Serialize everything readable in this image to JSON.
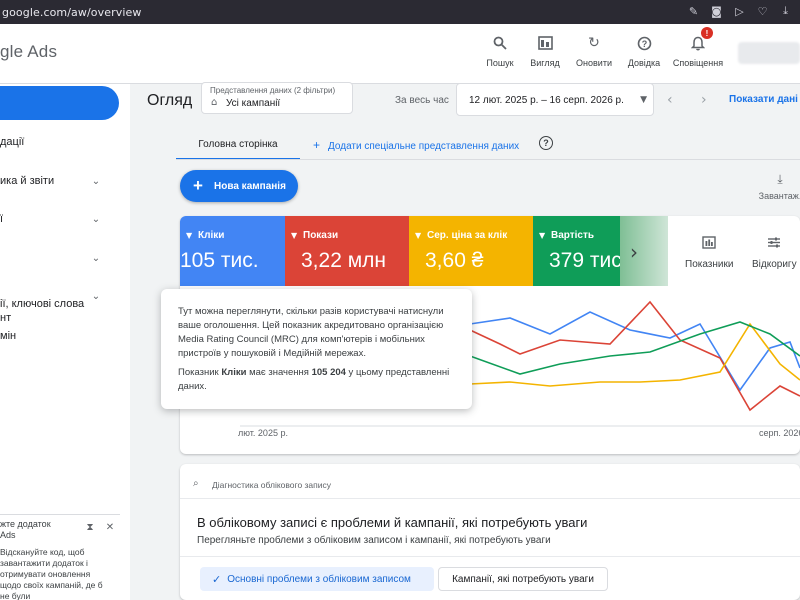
{
  "browser": {
    "url": "google.com/aw/overview",
    "icons": [
      "edit-icon",
      "camera-icon",
      "send-icon",
      "heart-icon",
      "download-icon"
    ]
  },
  "header": {
    "logo_text": "gle Ads",
    "tools": [
      {
        "icon": "search-icon",
        "label": "Пошук"
      },
      {
        "icon": "view-icon",
        "label": "Вигляд"
      },
      {
        "icon": "refresh-icon",
        "label": "Оновити"
      },
      {
        "icon": "help-icon",
        "label": "Довідка"
      },
      {
        "icon": "bell-icon",
        "label": "Сповіщення",
        "badge": "!"
      }
    ]
  },
  "sidebar": {
    "items": [
      {
        "label": "дації",
        "expandable": false
      },
      {
        "label": "ика й звіти",
        "expandable": true
      },
      {
        "label": "ї",
        "expandable": true
      },
      {
        "label": "",
        "expandable": true
      },
      {
        "label": "ії, ключові слова\nнт",
        "expandable": true
      },
      {
        "label": "мін",
        "expandable": false
      }
    ],
    "promo": {
      "title": "жте додаток\nAds",
      "body": "Відскануйте код, щоб\nзавантажити додаток і\nотримувати оновлення\nщодо своїх кампаній, де б\nне були"
    }
  },
  "main": {
    "title": "Огляд",
    "data_view": {
      "caption": "Представлення даних (2 фільтри)",
      "value": "Усі кампанії"
    },
    "period_label": "За весь час",
    "date_range": "12 лют. 2025 р. – 16 серп. 2026 р.",
    "show_last": "Показати дані з",
    "tabs": {
      "main": "Головна сторінка",
      "add": "Додати спеціальне представлення даних"
    },
    "new_campaign": "Нова кампанія",
    "download_label": "Завантаж."
  },
  "metrics": [
    {
      "name": "Кліки",
      "value": "105 тис.",
      "color": "#4285f4"
    },
    {
      "name": "Покази",
      "value": "3,22 млн",
      "color": "#db4437"
    },
    {
      "name": "Сер. ціна за клік",
      "value": "3,60 ₴",
      "color": "#f4b400"
    },
    {
      "name": "Вартість",
      "value": "379 тис. ₴",
      "color": "#0f9d58"
    }
  ],
  "metric_tools": [
    {
      "icon": "metrics-icon",
      "label": "Показники"
    },
    {
      "icon": "adjust-icon",
      "label": "Відкоригу"
    }
  ],
  "chart": {
    "axis_start": "лют. 2025 р.",
    "axis_end": "серп. 2026 р."
  },
  "tooltip": {
    "p1": "Тут можна переглянути, скільки разів користувачі натиснули ваше оголошення. Цей показник акредитовано організацією Media Rating Council (MRC) для комп'ютерів і мобільних пристроїв у пошуковій і Медійній мережах.",
    "p2_prefix": "Показник ",
    "p2_metric": "Кліки",
    "p2_mid": " має значення ",
    "p2_value": "105 204",
    "p2_suffix": " у цьому представленні даних."
  },
  "diagnostics": {
    "header": "Діагностика облікового запису",
    "title": "В обліковому записі є проблеми й кампанії, які потребують уваги",
    "subtitle": "Перегляньте проблеми з обліковим записом і кампанії, які потребують уваги",
    "chip_main": "Основні проблеми з обліковим записом",
    "chip_second": "Кампанії, які потребують уваги"
  }
}
